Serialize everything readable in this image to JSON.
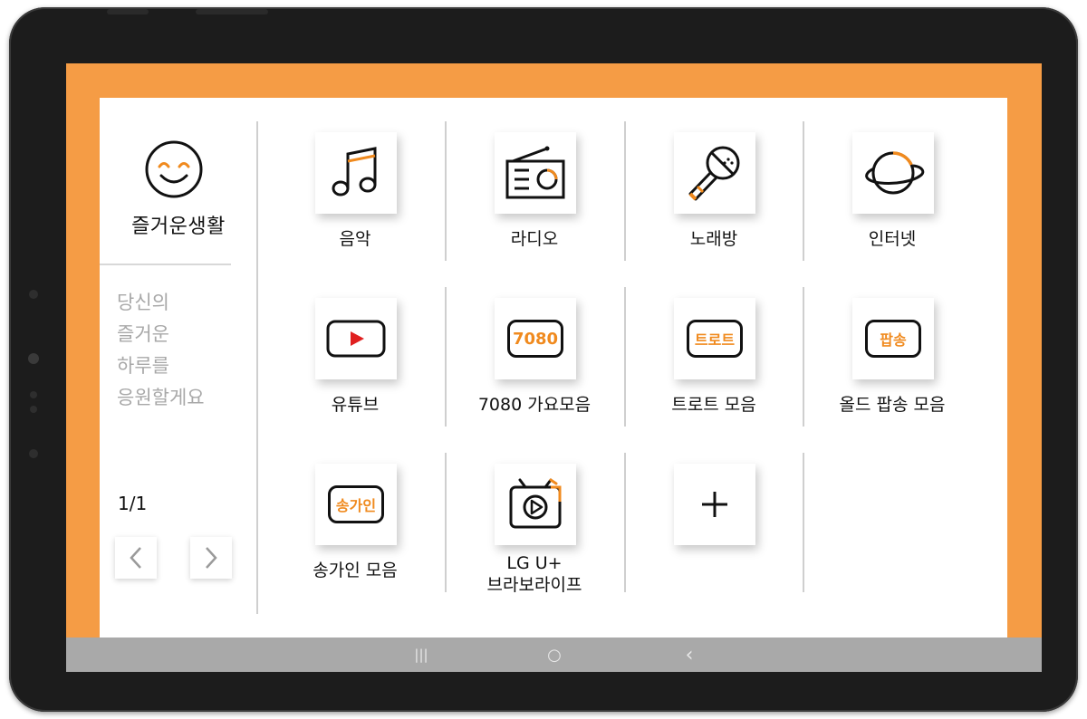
{
  "colors": {
    "accent": "#f59c45",
    "icon_orange": "#f08a1e",
    "youtube_red": "#e02020"
  },
  "sidebar": {
    "title": "즐거운생활",
    "tagline": [
      "당신의",
      "즐거운",
      "하루를",
      "응원할게요"
    ],
    "page_indicator": "1/1"
  },
  "tiles": [
    {
      "label": [
        "음악"
      ],
      "icon": "music-note-icon"
    },
    {
      "label": [
        "라디오"
      ],
      "icon": "radio-icon"
    },
    {
      "label": [
        "노래방"
      ],
      "icon": "microphone-icon"
    },
    {
      "label": [
        "인터넷"
      ],
      "icon": "planet-icon"
    },
    {
      "label": [
        "유튜브"
      ],
      "icon": "youtube-play-icon"
    },
    {
      "label": [
        "7080 가요모음"
      ],
      "icon": "tv-7080-icon",
      "badge": "7080"
    },
    {
      "label": [
        "트로트 모음"
      ],
      "icon": "tv-trot-icon",
      "badge": "트로트"
    },
    {
      "label": [
        "올드 팝송 모음"
      ],
      "icon": "tv-popsong-icon",
      "badge": "팝송"
    },
    {
      "label": [
        "송가인 모음"
      ],
      "icon": "tv-songgain-icon",
      "badge": "송가인"
    },
    {
      "label": [
        "LG U+",
        "브라보라이프"
      ],
      "icon": "tv-play-icon"
    },
    {
      "label": [],
      "icon": "plus-icon"
    }
  ],
  "navbar": {
    "recents": "|||",
    "home": "○",
    "back": "‹"
  }
}
